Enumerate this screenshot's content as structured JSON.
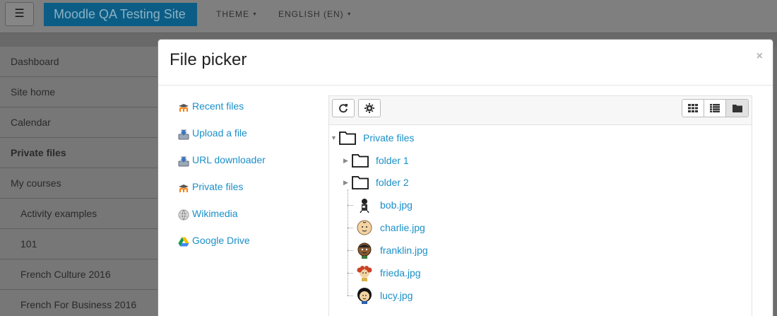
{
  "navbar": {
    "toggle_icon": "hamburger-icon",
    "site_name": "Moodle QA Testing Site",
    "menus": [
      "THEME",
      "ENGLISH (EN)"
    ]
  },
  "sidebar": {
    "items": [
      {
        "label": "Dashboard"
      },
      {
        "label": "Site home"
      },
      {
        "label": "Calendar"
      },
      {
        "label": "Private files"
      },
      {
        "label": "My courses"
      },
      {
        "label": "Activity examples"
      },
      {
        "label": "101"
      },
      {
        "label": "French Culture 2016"
      },
      {
        "label": "French For Business 2016"
      }
    ]
  },
  "file_picker": {
    "title": "File picker",
    "close_glyph": "×",
    "repositories": [
      {
        "label": "Recent files",
        "icon": "moodle-icon"
      },
      {
        "label": "Upload a file",
        "icon": "upload-icon"
      },
      {
        "label": "URL downloader",
        "icon": "url-download-icon"
      },
      {
        "label": "Private files",
        "icon": "moodle-icon"
      },
      {
        "label": "Wikimedia",
        "icon": "wikimedia-icon"
      },
      {
        "label": "Google Drive",
        "icon": "google-drive-icon"
      }
    ],
    "toolbar": {
      "refresh_icon": "refresh-icon",
      "settings_icon": "gear-icon",
      "views": [
        "icons-view-icon",
        "list-view-icon",
        "tree-view-icon"
      ],
      "active_view": "tree-view-icon"
    },
    "tree": {
      "root": "Private files",
      "folders": [
        "folder 1",
        "folder 2"
      ],
      "files": [
        "bob.jpg",
        "charlie.jpg",
        "franklin.jpg",
        "frieda.jpg",
        "lucy.jpg"
      ]
    }
  },
  "colors": {
    "link": "#1a8fc8",
    "brand": "#0c5d85",
    "overlay": "#7f7f7f"
  }
}
